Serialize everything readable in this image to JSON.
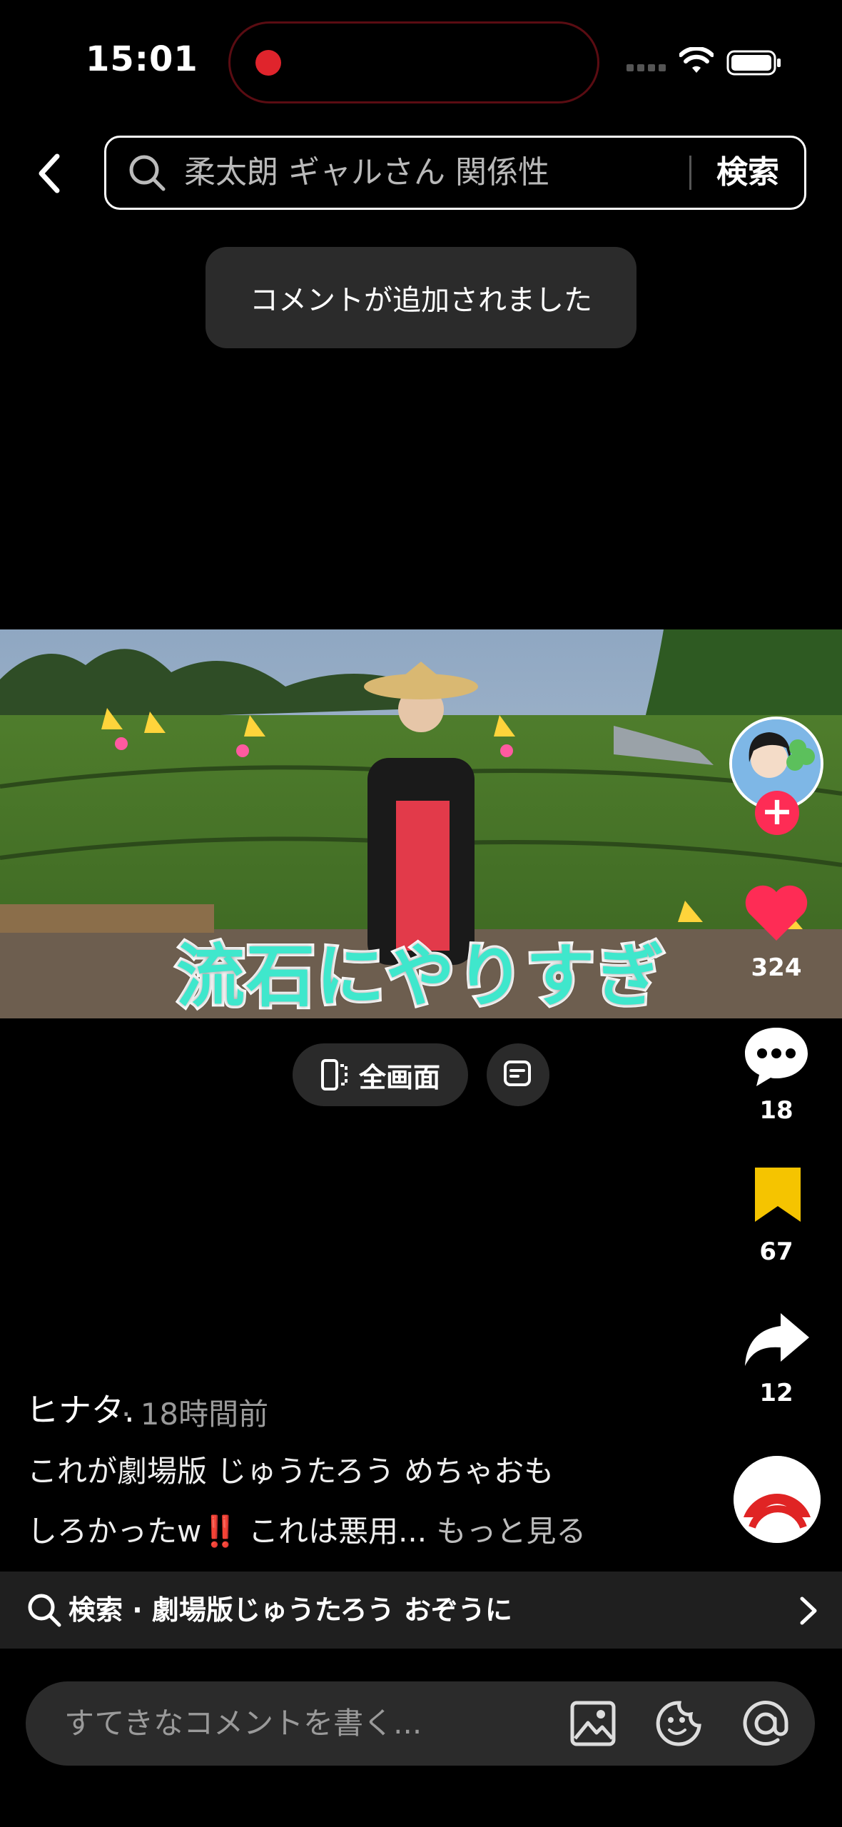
{
  "status_bar": {
    "time": "15:01"
  },
  "search": {
    "query": "柔太朗 ギャルさん 関係性",
    "submit_label": "検索"
  },
  "toast": {
    "message": "コメントが追加されました"
  },
  "video": {
    "caption": "流石にやりすぎ"
  },
  "pills": {
    "fullscreen_label": "全画面"
  },
  "rail": {
    "likes": "324",
    "comments": "18",
    "bookmarks": "67",
    "shares": "12"
  },
  "post": {
    "author": "ヒナタ.",
    "time": "· 18時間前",
    "desc_part1": "これが劇場版 じゅうたろう  めちゃおも",
    "desc_part2": "しろかったw",
    "desc_bang": "‼️",
    "desc_part3": " これは悪用...",
    "more_label": " もっと見る"
  },
  "related_search": {
    "label": "検索 · 劇場版じゅうたろう おぞうに"
  },
  "comment_input": {
    "placeholder": "すてきなコメントを書く..."
  },
  "colors": {
    "accent": "#fe2c55",
    "like": "#fe2c55",
    "bookmark": "#f5c400",
    "caption": "#3fe7cc"
  }
}
